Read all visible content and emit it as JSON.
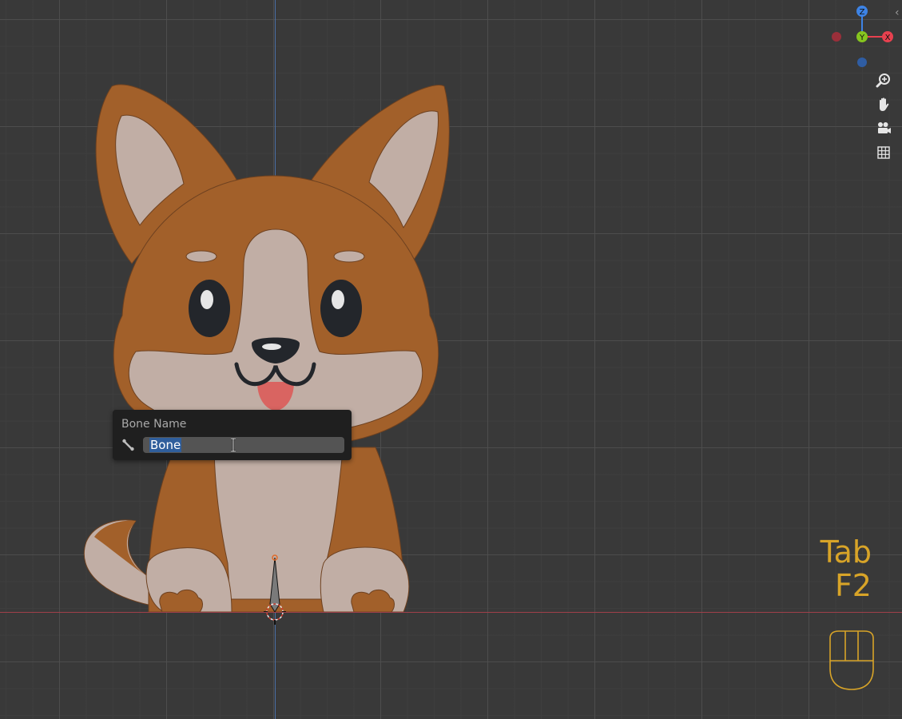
{
  "viewport": {
    "background": "#393939",
    "z_axis_color": "#4a6fa5",
    "x_axis_color": "#a0404a"
  },
  "popup": {
    "title": "Bone Name",
    "icon": "bone-icon",
    "field_value": "Bone",
    "field_selected": true
  },
  "navigation_gizmo": {
    "axes": [
      "Z",
      "Y",
      "X"
    ],
    "x_color": "#e8414f",
    "y_color": "#86c51f",
    "z_color": "#3d83e5"
  },
  "viewport_buttons": [
    {
      "icon": "zoom-icon"
    },
    {
      "icon": "hand-pan-icon"
    },
    {
      "icon": "camera-icon"
    },
    {
      "icon": "grid-icon"
    }
  ],
  "keys_overlay": {
    "line1": "Tab",
    "line2": "F2",
    "color": "#d8a428"
  },
  "character": {
    "fur": "#a2602a",
    "cream": "#c1aea5",
    "tongue": "#d96461"
  }
}
